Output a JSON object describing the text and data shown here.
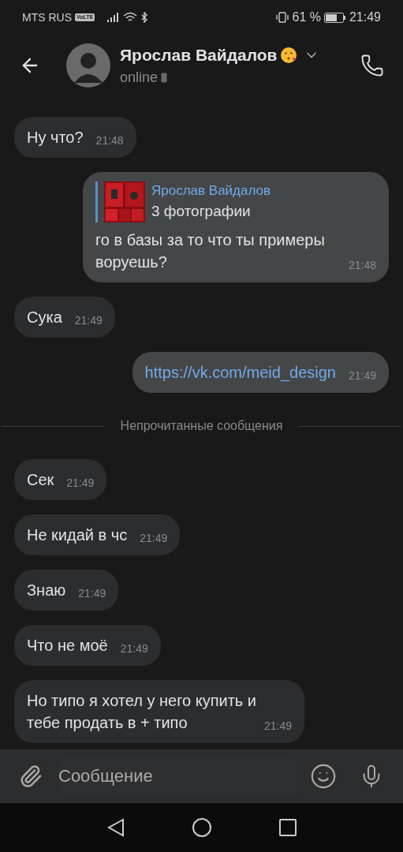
{
  "status_bar": {
    "carrier": "MTS RUS",
    "volte": "VoLTE",
    "battery_percent": "61 %",
    "time": "21:49"
  },
  "header": {
    "name": "Ярослав Вайдалов",
    "status": "online"
  },
  "messages": [
    {
      "kind": "incoming",
      "text": "Ну что?",
      "time": "21:48"
    },
    {
      "kind": "outgoing",
      "text": "го в базы за то что ты примеры воруешь?",
      "time": "21:48",
      "reply": {
        "author": "Ярослав Вайдалов",
        "caption": "3 фотографии"
      }
    },
    {
      "kind": "incoming",
      "text": "Сука",
      "time": "21:49"
    },
    {
      "kind": "outgoing",
      "link": "https://vk.com/meid_design",
      "time": "21:49"
    },
    {
      "kind": "divider",
      "text": "Непрочитанные сообщения"
    },
    {
      "kind": "incoming",
      "text": "Сек",
      "time": "21:49"
    },
    {
      "kind": "incoming",
      "text": "Не кидай в чс",
      "time": "21:49"
    },
    {
      "kind": "incoming",
      "text": "Знаю",
      "time": "21:49"
    },
    {
      "kind": "incoming",
      "text": "Что не моё",
      "time": "21:49"
    },
    {
      "kind": "incoming",
      "text": "Но типо я хотел у него купить и тебе продать в + типо",
      "time": "21:49"
    }
  ],
  "composer": {
    "placeholder": "Сообщение"
  }
}
